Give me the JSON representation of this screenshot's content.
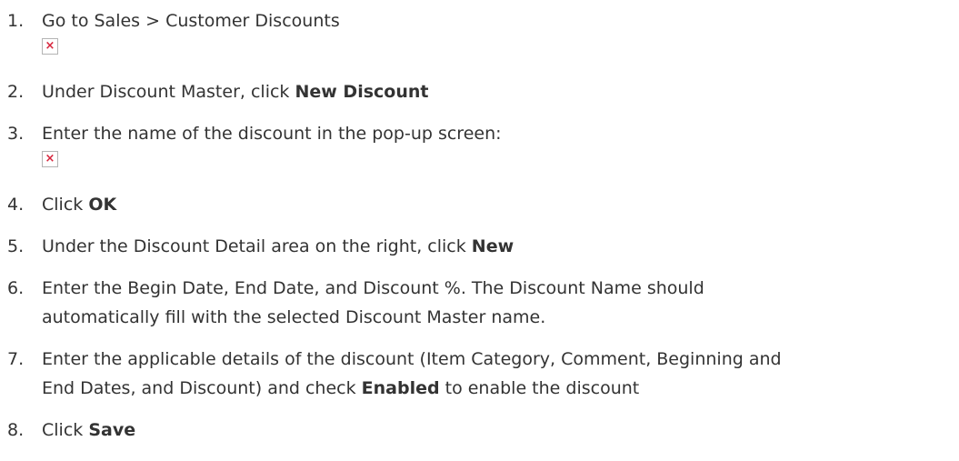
{
  "steps": [
    {
      "num": "1.",
      "text": "Go to Sales > Customer Discounts",
      "image_icon": "broken-image-icon"
    },
    {
      "num": "2.",
      "pre": "Under Discount Master, click ",
      "bold": "New Discount"
    },
    {
      "num": "3.",
      "text": "Enter the name of the discount in the pop-up screen:",
      "image_icon": "broken-image-icon"
    },
    {
      "num": "4.",
      "pre": "Click ",
      "bold": "OK"
    },
    {
      "num": "5.",
      "pre": "Under the Discount Detail area on the right, click ",
      "bold": "New"
    },
    {
      "num": "6.",
      "line1": "Enter the Begin Date, End Date, and Discount %. The Discount Name should",
      "line2": "automatically fill with the selected Discount Master name."
    },
    {
      "num": "7.",
      "line1": "Enter the applicable details of the discount (Item Category, Comment, Beginning and",
      "pre": "End Dates, and Discount) and check ",
      "bold": "Enabled",
      "post": " to enable the discount"
    },
    {
      "num": "8.",
      "pre": "Click ",
      "bold": "Save"
    }
  ],
  "broken_image_glyph": "×",
  "colors": {
    "text": "#333333",
    "broken_image_x": "#d7263d",
    "broken_image_border": "#b4b4b4"
  }
}
